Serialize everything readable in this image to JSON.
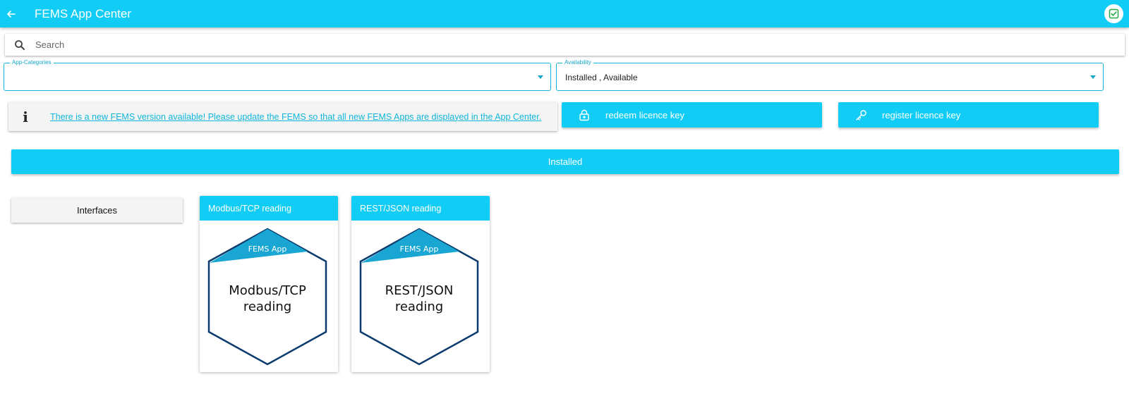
{
  "app": {
    "title": "FEMS App Center",
    "colors": {
      "primary": "#11ccf5",
      "hex_stroke": "#0b3b6e",
      "badge": "#1aa6d3"
    }
  },
  "search": {
    "placeholder": "Search",
    "value": ""
  },
  "filters": {
    "categories": {
      "label": "App-Categories",
      "value": ""
    },
    "availability": {
      "label": "Availability",
      "value": "Installed , Available"
    }
  },
  "notice": {
    "text": "There is a new FEMS version available! Please update the FEMS so that all new FEMS Apps are displayed in the App Center."
  },
  "actions": {
    "redeem": {
      "label": "redeem licence key",
      "icon": "lock-icon"
    },
    "register": {
      "label": "register licence key",
      "icon": "key-icon"
    }
  },
  "section": {
    "label": "Installed"
  },
  "categories": [
    {
      "label": "Interfaces"
    }
  ],
  "apps": [
    {
      "title": "Modbus/TCP reading",
      "badge": "FEMS App",
      "line1": "Modbus/TCP",
      "line2": "reading"
    },
    {
      "title": "REST/JSON reading",
      "badge": "FEMS App",
      "line1": "REST/JSON",
      "line2": "reading"
    }
  ]
}
